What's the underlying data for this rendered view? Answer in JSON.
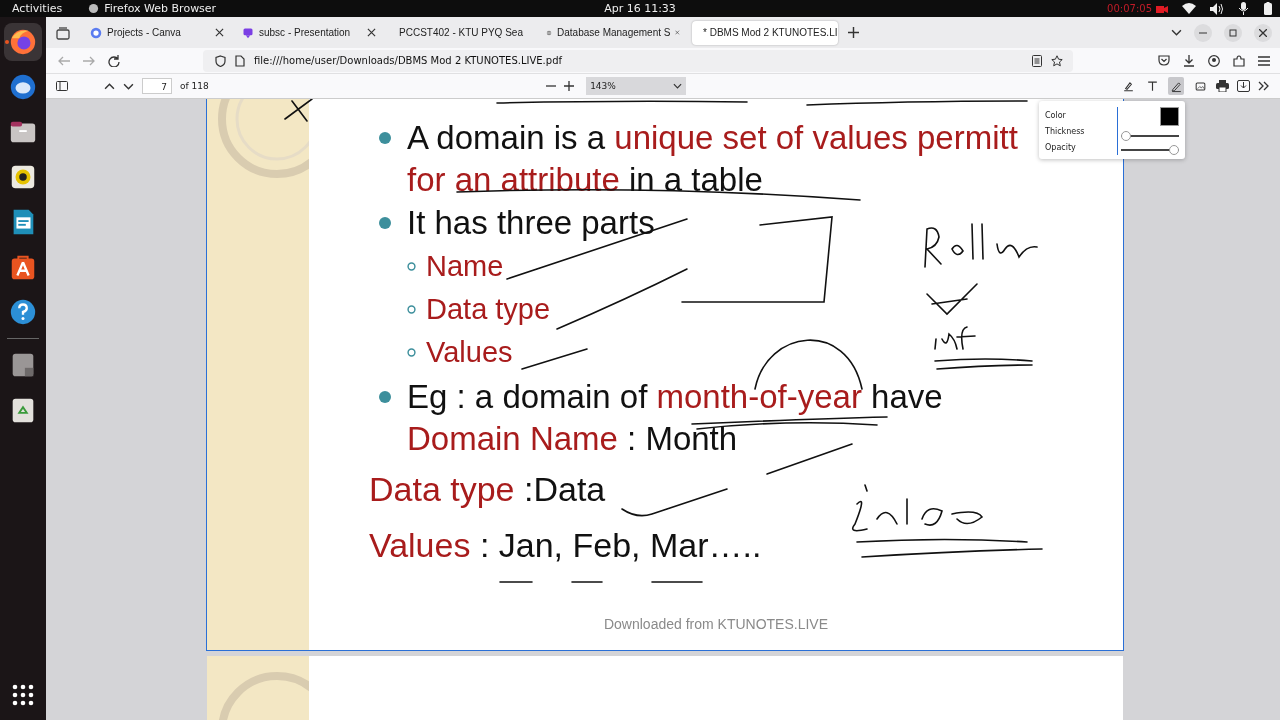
{
  "top_bar": {
    "activities": "Activities",
    "app": "Firefox Web Browser",
    "clock": "Apr 16  11:33",
    "recording": "00:07:05"
  },
  "dock": [
    {
      "kind": "firefox",
      "selected": true
    },
    {
      "kind": "mail",
      "selected": false
    },
    {
      "kind": "files",
      "selected": false
    },
    {
      "kind": "speaker",
      "selected": false
    },
    {
      "kind": "writer",
      "selected": false
    },
    {
      "kind": "store",
      "selected": false
    },
    {
      "kind": "help",
      "selected": false
    },
    {
      "kind": "drive",
      "selected": false
    },
    {
      "kind": "trash",
      "selected": false
    }
  ],
  "tabs": [
    {
      "kind": "canva",
      "title": "Projects - Canva",
      "selected": false
    },
    {
      "kind": "slides",
      "title": "subsc - Presentation",
      "selected": false
    },
    {
      "kind": "web",
      "title": "PCCST402 - KTU PYQ Sea",
      "selected": false
    },
    {
      "kind": "web",
      "title": "Database Management S",
      "selected": false
    },
    {
      "kind": "pdf",
      "title": "* DBMS Mod 2 KTUNOTES.LI",
      "selected": true
    }
  ],
  "address": "file:///home/user/Downloads/DBMS Mod 2 KTUNOTES.LIVE.pdf",
  "pdf_toolbar": {
    "page": "7",
    "page_count": "of 118",
    "zoom": "143%",
    "tools": [
      {
        "kind": "highlight",
        "selected": false
      },
      {
        "kind": "text",
        "selected": false
      },
      {
        "kind": "draw",
        "selected": true
      },
      {
        "kind": "image",
        "selected": false
      }
    ]
  },
  "ink_popup": {
    "labels": [
      "Color",
      "Thickness",
      "Opacity"
    ],
    "color": "#000000",
    "thickness": {
      "level": 0.0
    },
    "opacity": {
      "level": 1.0
    }
  },
  "slide": {
    "lines": [
      {
        "kind": "bullet",
        "segments": [
          {
            "text": "A domain is a ",
            "red": false
          },
          {
            "text": "unique set of values permitt",
            "red": true
          }
        ]
      },
      {
        "kind": "continuation",
        "segments": [
          {
            "text": "for an attribute",
            "red": true
          },
          {
            "text": " in a table",
            "red": false
          }
        ]
      },
      {
        "kind": "bullet",
        "segments": [
          {
            "text": "It has three parts",
            "red": false
          }
        ]
      },
      {
        "kind": "sub",
        "segments": [
          {
            "text": "Name",
            "red": true
          }
        ]
      },
      {
        "kind": "sub",
        "segments": [
          {
            "text": "Data type",
            "red": true
          }
        ]
      },
      {
        "kind": "sub",
        "segments": [
          {
            "text": "Values",
            "red": true
          }
        ]
      },
      {
        "kind": "bullet",
        "segments": [
          {
            "text": "Eg : a domain of ",
            "red": false
          },
          {
            "text": "month-of-year",
            "red": true
          },
          {
            "text": " have",
            "red": false
          }
        ]
      },
      {
        "kind": "continuation",
        "segments": [
          {
            "text": "Domain Name",
            "red": true
          },
          {
            "text": " : Month",
            "red": false
          }
        ]
      },
      {
        "kind": "plain",
        "segments": [
          {
            "text": "Data type",
            "red": true
          },
          {
            "text": " :Data",
            "red": false
          }
        ]
      },
      {
        "kind": "plain",
        "segments": [
          {
            "text": "Values",
            "red": true
          },
          {
            "text": " : Jan, Feb, Mar…..",
            "red": false
          }
        ]
      }
    ],
    "footer": "Downloaded from KTUNOTES.LIVE"
  }
}
